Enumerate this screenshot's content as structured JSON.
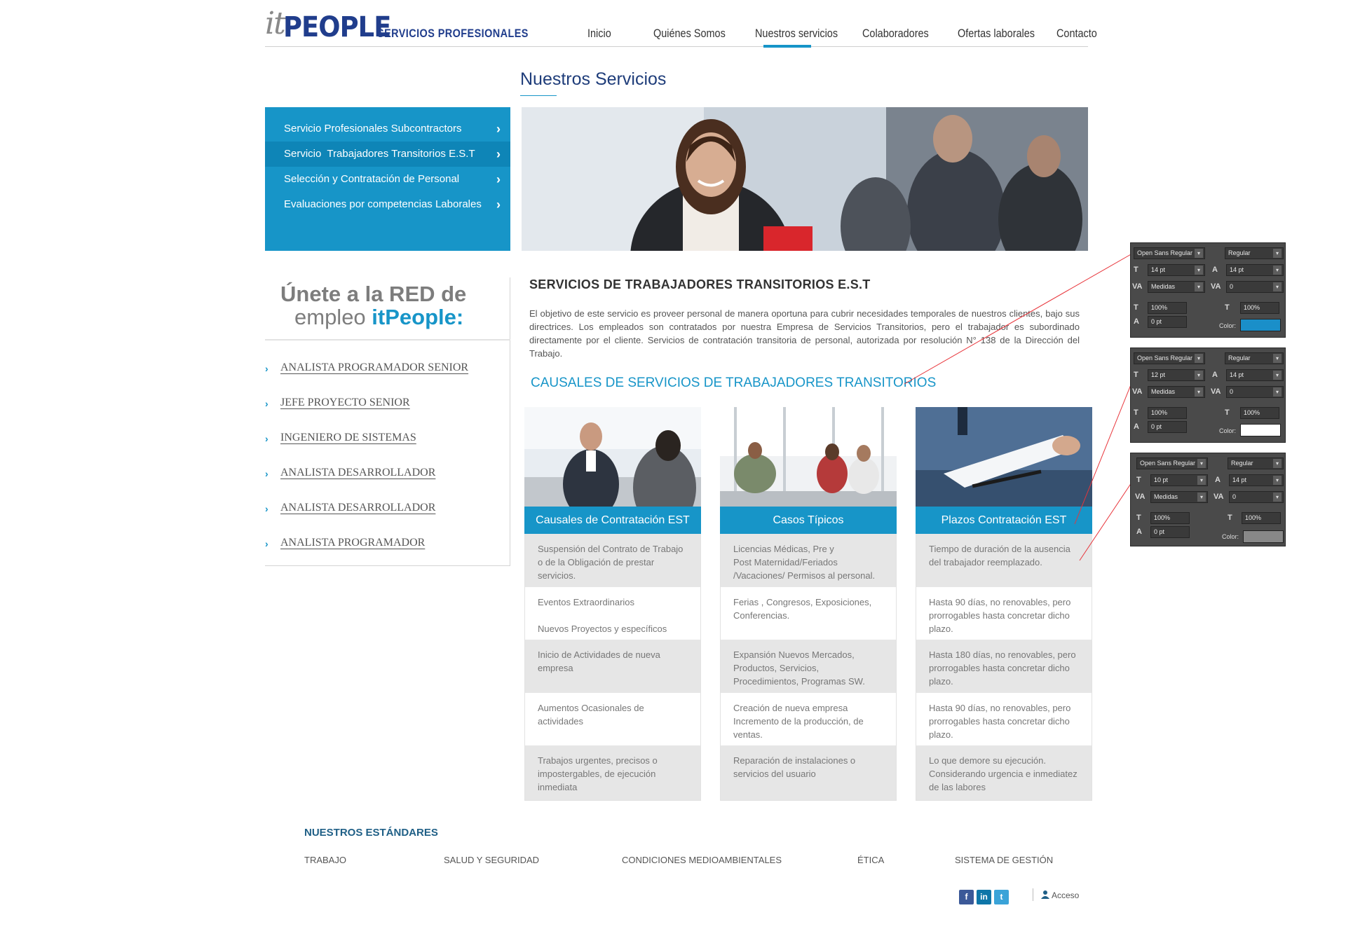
{
  "brand": {
    "logo_it": "it",
    "logo_people": "PEOPLE",
    "tagline": "SERVICIOS PROFESIONALES"
  },
  "nav": [
    {
      "label": "Inicio"
    },
    {
      "label": "Quiénes Somos"
    },
    {
      "label": "Nuestros servicios",
      "active": true
    },
    {
      "label": "Colaboradores"
    },
    {
      "label": "Ofertas laborales"
    },
    {
      "label": "Contacto"
    }
  ],
  "page_title": "Nuestros Servicios",
  "service_menu": [
    {
      "label": "Servicio Profesionales Subcontractors",
      "icon": "chevron-right-icon"
    },
    {
      "label": "Servicio  Trabajadores Transitorios E.S.T",
      "icon": "chevron-right-icon",
      "active": true
    },
    {
      "label": "Selección y Contratación de Personal",
      "icon": "chevron-right-icon"
    },
    {
      "label": "Evaluaciones por competencias Laborales",
      "icon": "chevron-right-icon"
    }
  ],
  "join": {
    "line1": "Únete a la RED de",
    "line2_prefix": "empleo ",
    "line2_brand": "itPeople:"
  },
  "jobs": [
    "ANALISTA PROGRAMADOR SENIOR",
    "JEFE PROYECTO SENIOR",
    "INGENIERO DE SISTEMAS",
    "ANALISTA DESARROLLADOR",
    "ANALISTA DESARROLLADOR",
    "ANALISTA PROGRAMADOR"
  ],
  "content": {
    "section_title": "SERVICIOS DE TRABAJADORES TRANSITORIOS E.S.T",
    "body": "El objetivo de este servicio es proveer personal de manera oportuna para cubrir necesidades temporales de nuestros clientes, bajo sus directrices. Los empleados son contratados por nuestra Empresa de Servicios Transitorios, pero el trabajador es subordinado directamente por el cliente. Servicios de contratación transitoria de personal, autorizada por resolución N° 138 de la Dirección del Trabajo.",
    "causales_title": "CAUSALES DE SERVICIOS DE TRABAJADORES TRANSITORIOS"
  },
  "cards": [
    {
      "title": "Causales de Contratación EST",
      "rows": [
        "Suspensión del Contrato de Trabajo o de la Obligación de prestar servicios.",
        "Eventos Extraordinarios\n\nNuevos Proyectos y específicos",
        "Inicio de Actividades de nueva empresa",
        "Aumentos Ocasionales de actividades",
        "Trabajos urgentes, precisos o impostergables, de ejecución inmediata"
      ]
    },
    {
      "title": "Casos Típicos",
      "rows": [
        "Licencias Médicas, Pre y\nPost Maternidad/Feriados\n/Vacaciones/ Permisos al personal.",
        "Ferias , Congresos, Exposiciones, Conferencias.",
        "Expansión Nuevos Mercados, Productos, Servicios, Procedimientos, Programas SW.",
        "Creación de nueva empresa\nIncremento de la producción, de ventas.",
        "Reparación de instalaciones o servicios del usuario"
      ]
    },
    {
      "title": "Plazos Contratación EST",
      "rows": [
        "Tiempo de duración de la ausencia del trabajador reemplazado.",
        "Hasta 90 días, no renovables, pero prorrogables hasta concretar dicho plazo.",
        "Hasta 180 días, no renovables, pero prorrogables hasta concretar dicho plazo.",
        "Hasta 90 días, no renovables, pero prorrogables hasta concretar dicho plazo.",
        "Lo que demore su ejecución. Considerando urgencia e inmediatez de las labores"
      ]
    }
  ],
  "footer": {
    "standards_title": "NUESTROS ESTÁNDARES",
    "standards": [
      "TRABAJO",
      "SALUD Y SEGURIDAD",
      "CONDICIONES MEDIOAMBIENTALES",
      "ÉTICA",
      "SISTEMA DE GESTIÓN"
    ],
    "social": [
      {
        "icon": "facebook-icon",
        "glyph": "f",
        "color": "#3b5998"
      },
      {
        "icon": "linkedin-icon",
        "glyph": "in",
        "color": "#0e76a8"
      },
      {
        "icon": "twitter-icon",
        "glyph": "t",
        "color": "#3aa3d8"
      }
    ],
    "access_label": "Acceso"
  },
  "type_panels": [
    {
      "font": "Open Sans Regular",
      "style": "Regular",
      "size": "14 pt",
      "leading": "14 pt",
      "kerning": "Medidas",
      "tracking": "0",
      "vscale": "100%",
      "hscale": "100%",
      "baseline": "0 pt",
      "color_label": "Color:",
      "color": "#1a8fc9"
    },
    {
      "font": "Open Sans Regular",
      "style": "Regular",
      "size": "12 pt",
      "leading": "14 pt",
      "kerning": "Medidas",
      "tracking": "0",
      "vscale": "100%",
      "hscale": "100%",
      "baseline": "0 pt",
      "color_label": "Color:",
      "color": "#ffffff"
    },
    {
      "font": "Open Sans Regular",
      "style": "Regular",
      "size": "10 pt",
      "leading": "14 pt",
      "kerning": "Medidas",
      "tracking": "0",
      "vscale": "100%",
      "hscale": "100%",
      "baseline": "0 pt",
      "color_label": "Color:",
      "color": "#888888"
    }
  ],
  "colors": {
    "accent": "#1795c8",
    "accent_dark": "#0e85b7",
    "brand_navy": "#203d8c",
    "annotation_red": "#e8343a"
  }
}
